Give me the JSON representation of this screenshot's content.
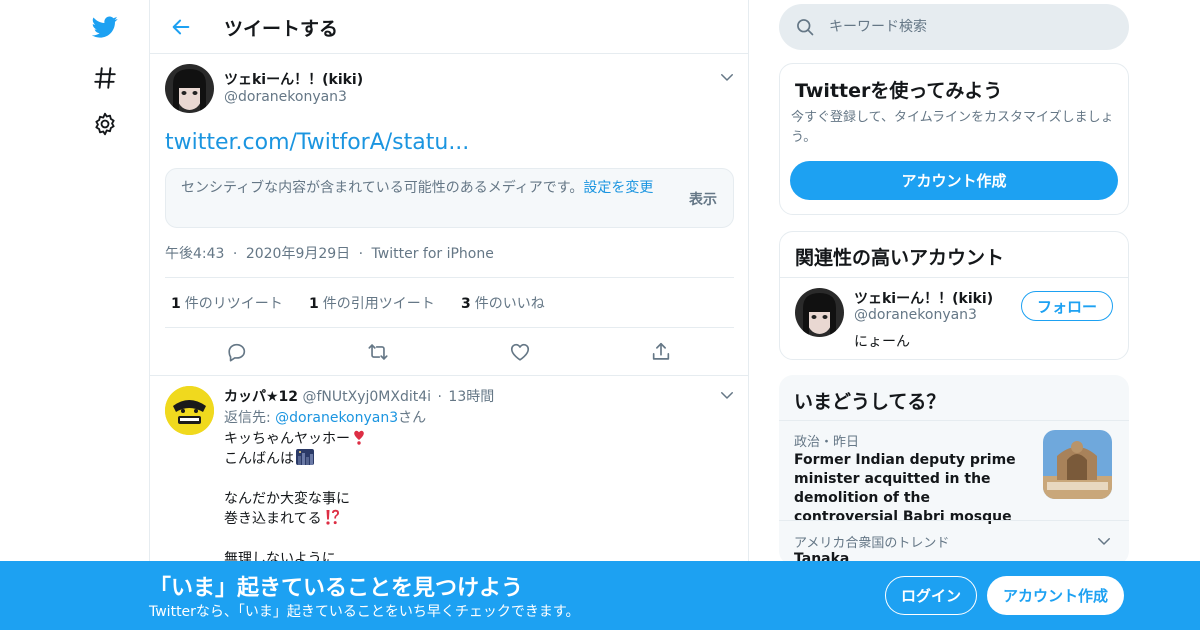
{
  "colors": {
    "accent": "#1da1f2",
    "link": "#1b95e0",
    "muted": "#657786",
    "text": "#14171a",
    "border": "#e6ecf0"
  },
  "nav": {
    "icons": [
      "twitter-logo-icon",
      "hashtag-icon",
      "gear-icon"
    ]
  },
  "header": {
    "title": "ツイートする"
  },
  "tweet": {
    "author_name": "ツェkiーん！！(kiki)",
    "author_handle": "@doranekonyan3",
    "link_text": "twitter.com/TwitforA/statu...",
    "sensitive_text": "センシティブな内容が含まれている可能性のあるメディアです。",
    "sensitive_link": "設定を変更",
    "sensitive_show": "表示",
    "time": "午後4:43",
    "date": "2020年9月29日",
    "client": "Twitter for iPhone",
    "retweets_count": "1",
    "retweets_label": "件のリツイート",
    "quotes_count": "1",
    "quotes_label": "件の引用ツイート",
    "likes_count": "3",
    "likes_label": "件のいいね"
  },
  "reply": {
    "name": "カッパ★12",
    "handle": "@fNUtXyj0MXdit4i",
    "time": "13時間",
    "reply_prefix": "返信先: ",
    "reply_to": "@doranekonyan3",
    "reply_suffix": "さん",
    "line1": "キッちゃんヤッホー",
    "line2": "こんばんは",
    "line3": "なんだか大変な事に",
    "line4": "巻き込まれてる",
    "line5": "無理しないように"
  },
  "search": {
    "placeholder": "キーワード検索"
  },
  "signup_card": {
    "title": "Twitterを使ってみよう",
    "description": "今すぐ登録して、タイムラインをカスタマイズしましょう。",
    "button": "アカウント作成"
  },
  "related_card": {
    "title": "関連性の高いアカウント",
    "name": "ツェkiーん！！(kiki)",
    "handle": "@doranekonyan3",
    "bio": "にょーん",
    "follow": "フォロー"
  },
  "trends_card": {
    "title": "いまどうしてる？",
    "item1_category": "政治・昨日",
    "item1_text": "Former Indian deputy prime minister acquitted in the demolition of the controversial Babri mosque",
    "item2_category": "アメリカ合衆国のトレンド",
    "item2_name": "Tanaka"
  },
  "banner": {
    "title": "「いま」起きていることを見つけよう",
    "subtitle": "Twitterなら、「いま」起きていることをいち早くチェックできます。",
    "login": "ログイン",
    "signup": "アカウント作成"
  }
}
